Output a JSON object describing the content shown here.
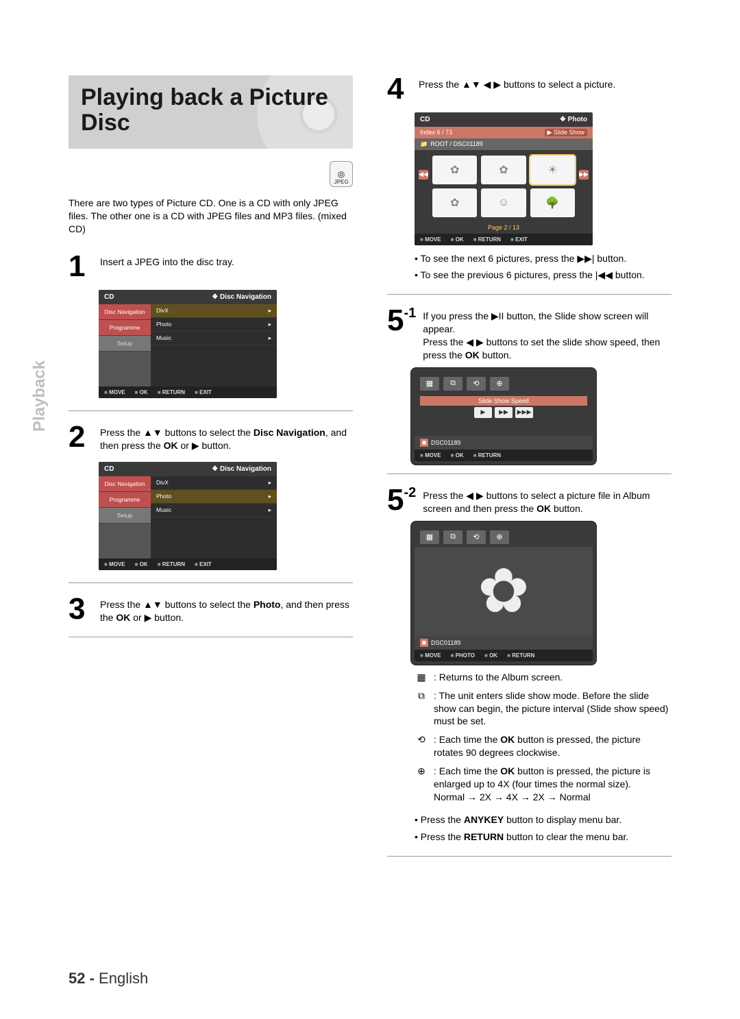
{
  "sidebar_tab": "Playback",
  "page_number": "52 -",
  "page_lang": "English",
  "title": "Playing back a Picture Disc",
  "jpeg_badge": "JPEG",
  "intro": "There are two types of Picture CD. One is a CD with only JPEG files. The other one is a CD with JPEG files and MP3 files. (mixed CD)",
  "step1": {
    "num": "1",
    "text": "Insert a JPEG into the disc tray."
  },
  "osd1": {
    "header_left": "CD",
    "header_right": "Disc Navigation",
    "side": [
      "Disc Navigation",
      "Programme",
      "Setup"
    ],
    "sub": [
      "DivX",
      "Photo",
      "Music"
    ],
    "bar": [
      "MOVE",
      "OK",
      "RETURN",
      "EXIT"
    ]
  },
  "step2": {
    "num": "2",
    "text_a": "Press the ▲▼ buttons to select the ",
    "text_b": "Disc Navigation",
    "text_c": ", and then press the ",
    "text_d": "OK",
    "text_e": " or ▶ button."
  },
  "step3": {
    "num": "3",
    "text_a": "Press the ▲▼ buttons to select the ",
    "text_b": "Photo",
    "text_c": ", and then press the ",
    "text_d": "OK",
    "text_e": " or ▶ button."
  },
  "step4": {
    "num": "4",
    "text": "Press the ▲▼ ◀ ▶ buttons to select a picture."
  },
  "osd_photo": {
    "header_left": "CD",
    "header_right": "Photo",
    "index_label": "Index   6   /   73",
    "slide_btn": "Slide Show",
    "path": "ROOT / DSC01189",
    "page_label": "Page   2   /   13",
    "bar": [
      "MOVE",
      "OK",
      "RETURN",
      "EXIT"
    ]
  },
  "post4_bullets": [
    "To see the next 6 pictures, press the ▶▶| button.",
    "To see the previous 6 pictures, press the |◀◀ button."
  ],
  "step5_1": {
    "num": "5",
    "sup": "-1",
    "text_a": "If you press the ▶II button, the Slide show screen will appear.",
    "text_b": "Press the ◀ ▶ buttons to set the slide show speed, then press the ",
    "text_c": "OK",
    "text_d": " button."
  },
  "osd_slide": {
    "speed_label": "Slide Show Speed",
    "name": "DSC01189",
    "bar": [
      "MOVE",
      "OK",
      "RETURN"
    ]
  },
  "step5_2": {
    "num": "5",
    "sup": "-2",
    "text_a": "Press the ◀ ▶ buttons to select a picture file in Album screen and then press the ",
    "text_b": "OK",
    "text_c": " button."
  },
  "osd_flower": {
    "name": "DSC01189",
    "bar": [
      "MOVE",
      "PHOTO",
      "OK",
      "RETURN"
    ]
  },
  "icon_list": [
    {
      "icon": "▦",
      "text": "Returns to the Album screen."
    },
    {
      "icon": "⧉",
      "text": "The unit enters slide show mode. Before the slide show can begin, the picture interval (Slide show speed) must be set."
    },
    {
      "icon": "⟲",
      "text": "Each time the OK button is pressed, the picture rotates 90 degrees clockwise."
    },
    {
      "icon": "⊕",
      "text": "Each time the OK button is pressed, the picture is enlarged up to 4X (four times the normal size)."
    }
  ],
  "zoom_sequence": "Normal → 2X → 4X → 2X → Normal",
  "final_bullets": [
    "Press the ANYKEY button to display menu bar.",
    "Press the RETURN button to clear the menu bar."
  ]
}
